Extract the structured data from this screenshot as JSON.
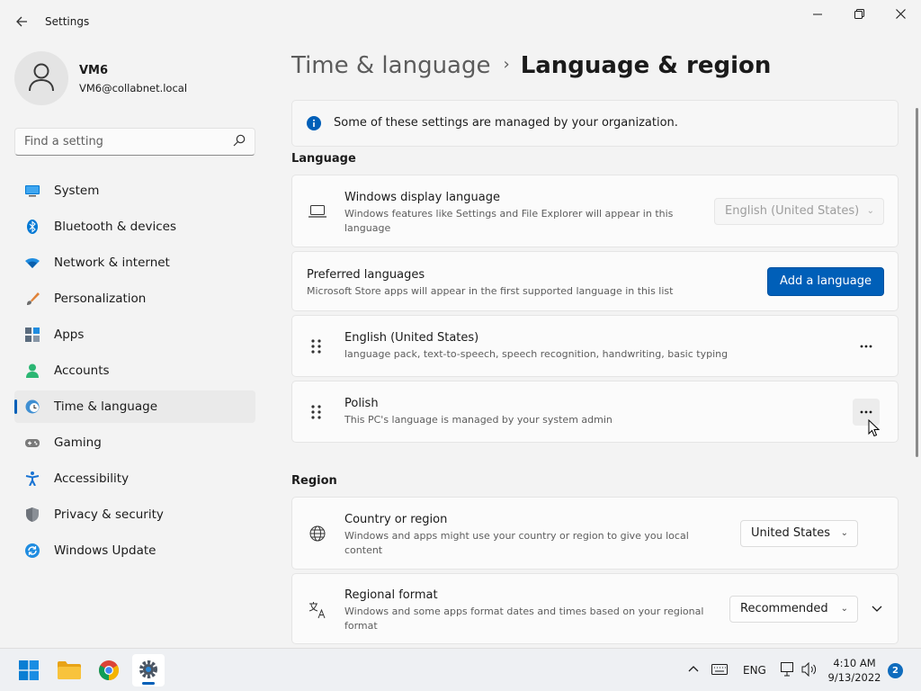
{
  "window": {
    "title": "Settings"
  },
  "profile": {
    "name": "VM6",
    "email": "VM6@collabnet.local"
  },
  "search": {
    "placeholder": "Find a setting"
  },
  "nav": {
    "items": [
      {
        "label": "System",
        "icon": "system-icon",
        "color": "#0078d4"
      },
      {
        "label": "Bluetooth & devices",
        "icon": "bluetooth-icon",
        "color": "#0078d4"
      },
      {
        "label": "Network & internet",
        "icon": "wifi-icon",
        "color": "#1f8ce0"
      },
      {
        "label": "Personalization",
        "icon": "brush-icon",
        "color": "#e0833a"
      },
      {
        "label": "Apps",
        "icon": "apps-icon",
        "color": "#5a6b7d"
      },
      {
        "label": "Accounts",
        "icon": "person-icon",
        "color": "#2bb673"
      },
      {
        "label": "Time & language",
        "icon": "globe-clock-icon",
        "color": "#3f8fd2"
      },
      {
        "label": "Gaming",
        "icon": "gamepad-icon",
        "color": "#7a7a7a"
      },
      {
        "label": "Accessibility",
        "icon": "accessibility-icon",
        "color": "#1873d3"
      },
      {
        "label": "Privacy & security",
        "icon": "shield-icon",
        "color": "#8a8f96"
      },
      {
        "label": "Windows Update",
        "icon": "update-icon",
        "color": "#1f8ce0"
      }
    ],
    "selected": "Time & language"
  },
  "breadcrumb": {
    "parent": "Time & language",
    "separator": "›",
    "current": "Language & region"
  },
  "info_banner": {
    "text": "Some of these settings are managed by your organization."
  },
  "language": {
    "section_title": "Language",
    "display_language": {
      "title": "Windows display language",
      "description": "Windows features like Settings and File Explorer will appear in this language",
      "value": "English (United States)"
    },
    "preferred": {
      "title": "Preferred languages",
      "description": "Microsoft Store apps will appear in the first supported language in this list",
      "button_label": "Add a language"
    },
    "installed": [
      {
        "name": "English (United States)",
        "details": "language pack, text-to-speech, speech recognition, handwriting, basic typing"
      },
      {
        "name": "Polish",
        "details": "This PC's language is managed by your system admin"
      }
    ]
  },
  "region": {
    "section_title": "Region",
    "country": {
      "title": "Country or region",
      "description": "Windows and apps might use your country or region to give you local content",
      "value": "United States"
    },
    "format": {
      "title": "Regional format",
      "description": "Windows and some apps format dates and times based on your regional format",
      "value": "Recommended"
    }
  },
  "taskbar": {
    "apps": [
      "start-icon",
      "file-explorer-icon",
      "chrome-icon",
      "settings-icon"
    ],
    "active_app": "settings-icon",
    "input_language": "ENG",
    "time": "4:10 AM",
    "date": "9/13/2022",
    "notification_count": "2"
  },
  "colors": {
    "accent": "#005fb8",
    "background": "#f3f3f3",
    "card": "#fbfbfb"
  }
}
